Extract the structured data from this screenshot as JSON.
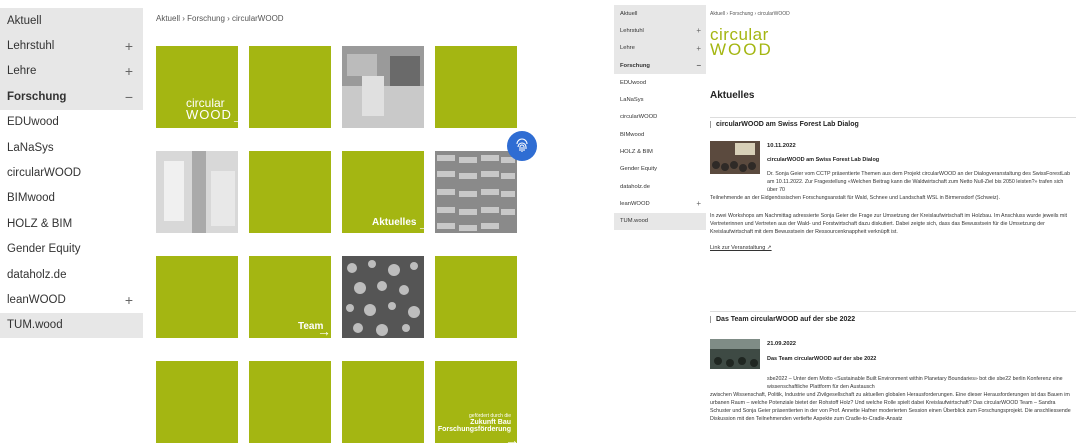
{
  "left": {
    "breadcrumb": "Aktuell › Forschung › circularWOOD",
    "nav": [
      {
        "label": "Aktuell",
        "toggle": "",
        "style": "grey"
      },
      {
        "label": "Lehrstuhl",
        "toggle": "+",
        "style": "grey"
      },
      {
        "label": "Lehre",
        "toggle": "+",
        "style": "grey"
      },
      {
        "label": "Forschung",
        "toggle": "−",
        "style": "grey-active"
      },
      {
        "label": "EDUwood",
        "toggle": "",
        "style": "sub"
      },
      {
        "label": "LaNaSys",
        "toggle": "",
        "style": "sub"
      },
      {
        "label": "circularWOOD",
        "toggle": "",
        "style": "sub"
      },
      {
        "label": "BIMwood",
        "toggle": "",
        "style": "sub"
      },
      {
        "label": "HOLZ & BIM",
        "toggle": "",
        "style": "sub"
      },
      {
        "label": "Gender Equity",
        "toggle": "",
        "style": "sub"
      },
      {
        "label": "dataholz.de",
        "toggle": "",
        "style": "sub"
      },
      {
        "label": "leanWOOD",
        "toggle": "+",
        "style": "sub"
      },
      {
        "label": "TUM.wood",
        "toggle": "",
        "style": "grey"
      }
    ],
    "tile_logo_line1": "circular",
    "tile_logo_line2": "WOOD",
    "tile_aktuelles": "Aktuelles",
    "tile_team": "Team",
    "funding_small": "gefördert durch die",
    "funding_big1": "Zukunft Bau",
    "funding_big2": "Forschungsförderung",
    "arrow": "→"
  },
  "right": {
    "breadcrumb": "Aktuell › Forschung › circularWOOD",
    "nav": [
      {
        "label": "Aktuell",
        "toggle": "",
        "style": "grey"
      },
      {
        "label": "Lehrstuhl",
        "toggle": "+",
        "style": "grey"
      },
      {
        "label": "Lehre",
        "toggle": "+",
        "style": "grey"
      },
      {
        "label": "Forschung",
        "toggle": "−",
        "style": "grey-active"
      },
      {
        "label": "EDUwood",
        "toggle": "",
        "style": "sub"
      },
      {
        "label": "LaNaSys",
        "toggle": "",
        "style": "sub"
      },
      {
        "label": "circularWOOD",
        "toggle": "",
        "style": "sub"
      },
      {
        "label": "BIMwood",
        "toggle": "",
        "style": "sub"
      },
      {
        "label": "HOLZ & BIM",
        "toggle": "",
        "style": "sub"
      },
      {
        "label": "Gender Equity",
        "toggle": "",
        "style": "sub"
      },
      {
        "label": "dataholz.de",
        "toggle": "",
        "style": "sub"
      },
      {
        "label": "leanWOOD",
        "toggle": "+",
        "style": "sub"
      },
      {
        "label": "TUM.wood",
        "toggle": "",
        "style": "grey"
      }
    ],
    "logo_line1": "circular",
    "logo_line2": "WOOD",
    "heading": "Aktuelles",
    "news1": {
      "section_title": "circularWOOD am Swiss Forest Lab Dialog",
      "date": "10.11.2022",
      "subtitle": "circularWOOD am Swiss Forest Lab Dialog",
      "para1": "Dr. Sonja Geier vom CCTP präsentierte Themen aus dem Projekt circularWOOD an der Dialogveranstaltung des SwissForestLab am 10.11.2022. Zur Fragestellung «Welchen Beitrag kann die Waldwirtschaft zum Netto Null-Ziel bis 2050 leisten?» trafen sich über 70",
      "para1b": "Teilnehmende an der Eidgenössischen Forschungsanstalt für Wald, Schnee und Landschaft WSL in Birmensdorf (Schweiz).",
      "para2": "In zwei Workshops am Nachmittag adressierte Sonja Geier die Frage zur Umsetzung der Kreislaufwirtschaft im Holzbau. Im Anschluss wurde jeweils mit Vertreterinnen und Vertreten aus der Wald- und Forstwirtschaft dazu diskutiert. Dabei zeigte sich, dass das Bewusstsein für die Umsetzung der Kreislaufwirtschaft mit dem Bewusstsein der Ressourcenknappheit verknüpft ist.",
      "link": "Link zur Veranstaltung ↗"
    },
    "news2": {
      "section_title": "Das Team circularWOOD auf der sbe 2022",
      "date": "21.09.2022",
      "subtitle": "Das Team circularWOOD auf der sbe 2022",
      "para1": "sbe2022 – Unter dem Motto «Sustainable Built Environment within Planetary Boundaries» bot die sbe22 berlin Konferenz eine wissenschaftliche Plattform für den Austausch",
      "para1b": "zwischen Wissenschaft, Politik, Industrie und Zivilgesellschaft zu aktuellen globalen Herausforderungen. Eine dieser Herausforderungen ist das Bauen im urbanen Raum – welche Potenziale bietet der Rohstoff Holz? Und welche Rolle spielt dabei Kreislaufwirtschaft? Das circularWOOD Team – Sandra Schuster und Sonja Geier präsentierten in der von Prof. Annette Hafner moderierten Session einen Überblick zum Forschungsprojekt. Die anschliessende Diskussion mit den Teilnehmenden vertiefte Aspekte zum Cradle-to-Cradle-Ansatz"
    }
  },
  "colors": {
    "accent": "#a4b612",
    "fingerprint": "#2f6dd3"
  }
}
